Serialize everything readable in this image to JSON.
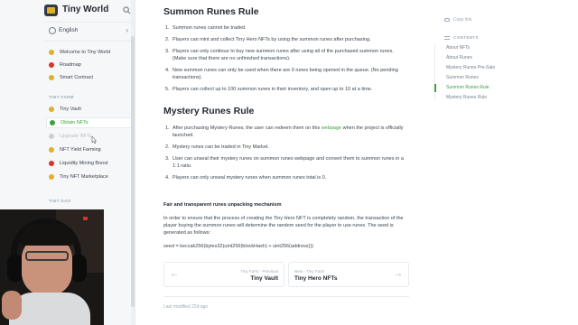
{
  "brand": {
    "title": "Tiny World"
  },
  "language": {
    "label": "English"
  },
  "sidebar": {
    "items": [
      {
        "label": "Welcome to Tiny World",
        "icon": "sun-icon",
        "color": "#e0b02a"
      },
      {
        "label": "Roadmap",
        "icon": "pin-icon",
        "color": "#d8342c"
      },
      {
        "label": "Smart Contract",
        "icon": "contract-icon",
        "color": "#e0b02a"
      }
    ],
    "section_farm": "TINY FARM",
    "farm_items": [
      {
        "label": "Tiny Vault",
        "icon": "vault-icon",
        "color": "#e0b02a"
      },
      {
        "label": "Obtain NFTs",
        "icon": "nft-icon",
        "color": "#3ca13b"
      },
      {
        "label": "Upgrade NFTs",
        "icon": "upgrade-icon",
        "color": "#b8c1c9"
      },
      {
        "label": "NFT Yield Farming",
        "icon": "farm-icon",
        "color": "#e0b02a"
      },
      {
        "label": "Liquidity Mining Boost",
        "icon": "rocket-icon",
        "color": "#d8342c"
      },
      {
        "label": "Tiny NFT Marketplace",
        "icon": "market-icon",
        "color": "#e0b02a"
      }
    ],
    "section_dao": "TINY DAO"
  },
  "main": {
    "summon_title": "Summon Runes Rule",
    "summon_rules": [
      "Summon runes cannot be traded.",
      "Players can mint and collect Tiny Hero NFTs by using the summon runes after purchasing.",
      "Players can only continue to buy new summon runes after using all of the purchased summon runes. (Make sure that there are no unfinished transactions).",
      "New summon runes can only be used when there are 0 runes being opened in the queue. (No pending transactions).",
      "Players can collect up to 100 summon runes in their inventory, and open up to 10 at a time."
    ],
    "mystery_title": "Mystery Runes Rule",
    "mystery_rule_1_before": "After purchasing Mystery Runes, the user can redeem them on this ",
    "mystery_rule_1_link": "webpage",
    "mystery_rule_1_after": " when the project is officially launched.",
    "mystery_rules": [
      "Mystery runes can be traded in Tiny Market.",
      "User can unseal their mystery runes on summon runes webpage and convert them to summon runes in a 1:1 ratio.",
      "Players can only unseal mystery runes when summon runes total is 0."
    ],
    "fair_title": "Fair and transparent runes unpacking mechanism",
    "fair_text": "In order to ensure that the process of creating the Tiny Hero NFT is completely random, the transaction of the player buying the summon runes will determine the random seed for the player to use runes. The seed is generated as follows:",
    "seed_formula": "seed = keccak256(bytes32(uint256(blockHash) + uint256(address)))",
    "prev": {
      "caption": "Tiny Farm - Previous",
      "title": "Tiny Vault"
    },
    "next": {
      "caption": "Next - Tiny Farm",
      "title": "Tiny Hero NFTs"
    },
    "modified": "Last modified 22d ago"
  },
  "toc": {
    "copy_link": "Copy link",
    "heading": "CONTENTS",
    "items": [
      "About NFTs",
      "About Runes",
      "Mystery Runes Pre-Sale",
      "Summon Runes",
      "Summon Runes Rule",
      "Mystery Runes Rule"
    ],
    "active_index": 4
  },
  "colors": {
    "accent": "#3ca13b",
    "sidebar_bg": "#f5f7f9",
    "text": "#3b454e"
  }
}
